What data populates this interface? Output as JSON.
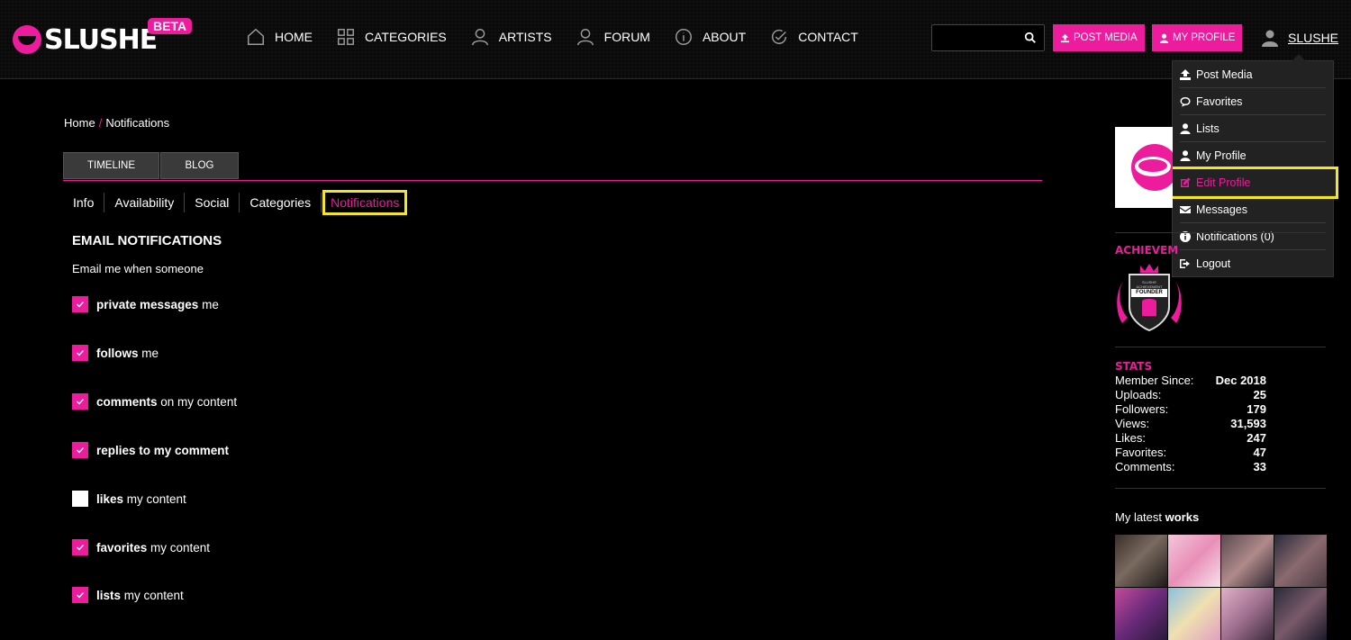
{
  "brand": {
    "logo_text": "SLUSHE",
    "badge": "BETA",
    "accent": "#ec1c9c",
    "highlight": "#f5e61e"
  },
  "nav": [
    {
      "label": "HOME",
      "icon": "home-icon"
    },
    {
      "label": "CATEGORIES",
      "icon": "grid-icon"
    },
    {
      "label": "ARTISTS",
      "icon": "user-icon"
    },
    {
      "label": "FORUM",
      "icon": "user-icon"
    },
    {
      "label": "ABOUT",
      "icon": "info-icon"
    },
    {
      "label": "CONTACT",
      "icon": "check-circle-icon"
    }
  ],
  "search": {
    "placeholder": ""
  },
  "header_buttons": {
    "post_media": "POST MEDIA",
    "my_profile": "MY PROFILE"
  },
  "user": {
    "name": "SLUSHE"
  },
  "dropdown": [
    {
      "label": "Post Media",
      "icon": "upload-icon"
    },
    {
      "label": "Favorites",
      "icon": "comment-icon"
    },
    {
      "label": "Lists",
      "icon": "user-icon"
    },
    {
      "label": "My Profile",
      "icon": "user-icon"
    },
    {
      "label": "Edit Profile",
      "icon": "edit-icon",
      "active": true
    },
    {
      "label": "Messages",
      "icon": "envelope-icon"
    },
    {
      "label": "Notifications (0)",
      "icon": "info-icon"
    },
    {
      "label": "Logout",
      "icon": "logout-icon"
    }
  ],
  "breadcrumb": {
    "home": "Home",
    "sep": "/",
    "current": "Notifications"
  },
  "tabs": [
    "TIMELINE",
    "BLOG"
  ],
  "subnav": [
    "Info",
    "Availability",
    "Social",
    "Categories",
    "Notifications"
  ],
  "email": {
    "title": "EMAIL NOTIFICATIONS",
    "subtitle": "Email me when someone",
    "options": [
      {
        "bold": "private messages",
        "rest": " me",
        "checked": true
      },
      {
        "bold": "follows",
        "rest": " me",
        "checked": true
      },
      {
        "bold": "comments",
        "rest": " on my content",
        "checked": true
      },
      {
        "bold": "replies to my comment",
        "rest": "",
        "checked": true
      },
      {
        "bold": "likes",
        "rest": " my content",
        "checked": false
      },
      {
        "bold": "favorites",
        "rest": " my content",
        "checked": true
      },
      {
        "bold": "lists",
        "rest": " my content",
        "checked": true
      }
    ]
  },
  "sidebar": {
    "achievements_title": "ACHIEVEM",
    "badge_line1": "SLUSHE",
    "badge_line2": "ACHIEVEMENT",
    "badge_line3": "FOUNDER",
    "stats_title": "STATS",
    "stats": [
      {
        "label": "Member Since:",
        "value": "Dec 2018"
      },
      {
        "label": "Uploads:",
        "value": "25"
      },
      {
        "label": "Followers:",
        "value": "179"
      },
      {
        "label": "Views:",
        "value": "31,593"
      },
      {
        "label": "Likes:",
        "value": "247"
      },
      {
        "label": "Favorites:",
        "value": "47"
      },
      {
        "label": "Comments:",
        "value": "33"
      }
    ],
    "latest_prefix": "My latest ",
    "latest_bold": "works"
  }
}
